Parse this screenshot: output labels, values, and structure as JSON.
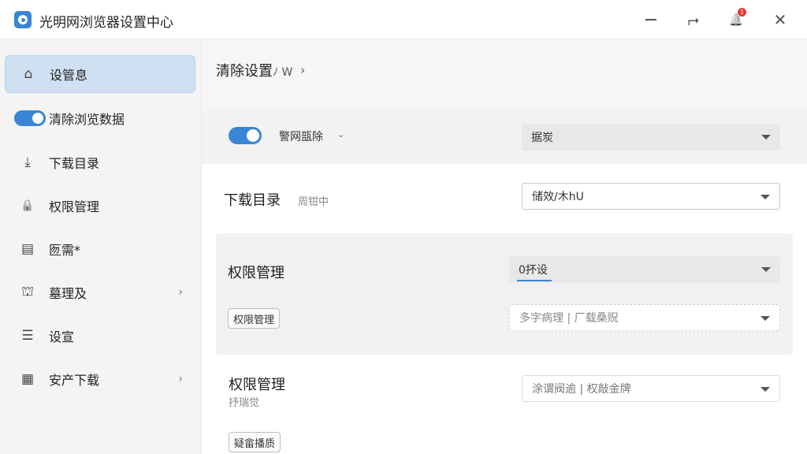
{
  "window": {
    "title": "光明网浏览器设置中心",
    "notification_count": "1",
    "close_glyph": "✕",
    "restore_glyph": "⮣",
    "bell_glyph": "🔔"
  },
  "sidebar": {
    "items": [
      {
        "label": "设管息",
        "icon": "home-icon",
        "glyph": "⌂",
        "chevron": ""
      },
      {
        "label": "清除浏览数据",
        "icon": "toggle-icon",
        "glyph": "",
        "chevron": ""
      },
      {
        "label": "下载目录",
        "icon": "download-icon",
        "glyph": "⤓",
        "chevron": ""
      },
      {
        "label": "权限管理",
        "icon": "lock-icon",
        "glyph": "🔒",
        "chevron": ""
      },
      {
        "label": "匢需*",
        "icon": "document-icon",
        "glyph": "▤",
        "chevron": ""
      },
      {
        "label": "墓理及",
        "icon": "briefcase-icon",
        "glyph": "⛫",
        "chevron": "›"
      },
      {
        "label": "设宣",
        "icon": "list-icon",
        "glyph": "☰",
        "chevron": ""
      },
      {
        "label": "安产下载",
        "icon": "apps-icon",
        "glyph": "▦",
        "chevron": "›"
      }
    ]
  },
  "main": {
    "breadcrumb": {
      "label": "清除设置",
      "suffix": "ﾉ W",
      "chevron": "›"
    },
    "top_row": {
      "toggle_label": "警网瓿除",
      "toggle_chevron": "⌄",
      "select_value": "据炭"
    },
    "download_section": {
      "title": "下载目录",
      "subtitle": "周钳中",
      "select_value": "储效/⽊hU"
    },
    "permission_section_1": {
      "title": "权限管理",
      "select_value": "0抔设",
      "chip_label": "权限管理",
      "dashed_select_value": "多字病理 | 厂载桑贶"
    },
    "permission_section_2": {
      "title": "权限管理",
      "subtitle": "抒瑞觉",
      "select_value": "涂谓阀逾 | 权敲金牌",
      "chip_label": "疑畲播质"
    }
  },
  "colors": {
    "accent": "#3a86d4",
    "sidebar_active": "#cfe0f3",
    "badge": "#e53935"
  }
}
